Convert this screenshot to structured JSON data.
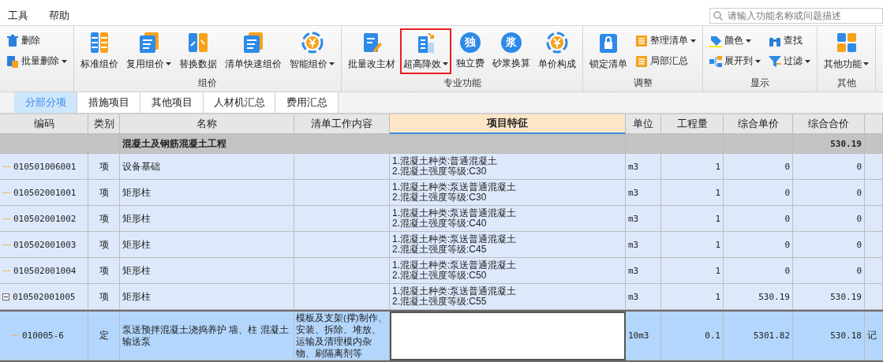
{
  "menu": [
    {
      "label": "工具"
    },
    {
      "label": "帮助"
    }
  ],
  "search": {
    "placeholder": "请输入功能名称或问题描述"
  },
  "ribbon": [
    {
      "items": [
        {
          "label": "删除",
          "kind": "small",
          "dropdown": false,
          "highlighted": false
        },
        {
          "label": "批量删除",
          "kind": "small",
          "dropdown": true,
          "highlighted": false
        }
      ]
    },
    {
      "label": "组价",
      "items": [
        {
          "label": "标准组价",
          "kind": "large",
          "dropdown": false,
          "highlighted": false
        },
        {
          "label": "复用组价",
          "kind": "large",
          "dropdown": true,
          "highlighted": false
        },
        {
          "label": "替换数据",
          "kind": "large",
          "dropdown": false,
          "highlighted": false
        },
        {
          "label": "清单快速组价",
          "kind": "large",
          "dropdown": false,
          "highlighted": false
        },
        {
          "label": "智能组价",
          "kind": "large",
          "dropdown": true,
          "highlighted": false
        }
      ]
    },
    {
      "label": "专业功能",
      "items": [
        {
          "label": "批量改主材",
          "kind": "large",
          "dropdown": false,
          "highlighted": false
        },
        {
          "label": "超高降效",
          "kind": "large",
          "dropdown": true,
          "highlighted": true
        },
        {
          "label": "独立费",
          "kind": "large",
          "glyph": "独",
          "dropdown": false,
          "highlighted": false
        },
        {
          "label": "砂浆换算",
          "kind": "large",
          "glyph": "浆",
          "dropdown": false,
          "highlighted": false
        },
        {
          "label": "单价构成",
          "kind": "large",
          "dropdown": false,
          "highlighted": false
        }
      ]
    },
    {
      "label": "调整",
      "items": [
        {
          "label": "锁定清单",
          "kind": "large",
          "dropdown": false,
          "highlighted": false
        },
        {
          "label": "整理清单",
          "kind": "small",
          "dropdown": true,
          "highlighted": false
        },
        {
          "label": "局部汇总",
          "kind": "small",
          "dropdown": false,
          "highlighted": false
        }
      ]
    },
    {
      "label": "显示",
      "items": [
        {
          "label": "颜色",
          "kind": "small",
          "dropdown": true,
          "highlighted": false
        },
        {
          "label": "展开到",
          "kind": "small",
          "dropdown": true,
          "highlighted": false
        },
        {
          "label": "查找",
          "kind": "small",
          "dropdown": false,
          "highlighted": false
        },
        {
          "label": "过滤",
          "kind": "small",
          "dropdown": true,
          "highlighted": false
        }
      ]
    },
    {
      "label": "其他",
      "items": [
        {
          "label": "其他功能",
          "kind": "large",
          "dropdown": true,
          "highlighted": false
        }
      ]
    }
  ],
  "tabs": [
    {
      "label": "分部分项",
      "selected": true
    },
    {
      "label": "措施项目",
      "selected": false
    },
    {
      "label": "其他项目",
      "selected": false
    },
    {
      "label": "人材机汇总",
      "selected": false
    },
    {
      "label": "费用汇总",
      "selected": false
    }
  ],
  "table": {
    "columns": [
      "编码",
      "类别",
      "名称",
      "清单工作内容",
      "项目特征",
      "单位",
      "工程量",
      "综合单价",
      "综合合价"
    ],
    "rows": [
      {
        "kind": "group",
        "name": "混凝土及钢筋混凝土工程",
        "total": "530.19",
        "selected": false
      },
      {
        "kind": "item",
        "code": "010501006001",
        "type": "项",
        "name": "设备基础",
        "feature": [
          "1.混凝土种类:普通混凝土",
          "2.混凝土强度等级:C30"
        ],
        "unit": "m3",
        "qty": "1",
        "price": "0",
        "total": "0",
        "selected": false,
        "expanded": false
      },
      {
        "kind": "item",
        "code": "010502001001",
        "type": "项",
        "name": "矩形柱",
        "feature": [
          "1.混凝土种类:泵送普通混凝土",
          "2.混凝土强度等级:C30"
        ],
        "unit": "m3",
        "qty": "1",
        "price": "0",
        "total": "0",
        "selected": false,
        "expanded": false
      },
      {
        "kind": "item",
        "code": "010502001002",
        "type": "项",
        "name": "矩形柱",
        "feature": [
          "1.混凝土种类:泵送普通混凝土",
          "2.混凝土强度等级:C40"
        ],
        "unit": "m3",
        "qty": "1",
        "price": "0",
        "total": "0",
        "selected": false,
        "expanded": false
      },
      {
        "kind": "item",
        "code": "010502001003",
        "type": "项",
        "name": "矩形柱",
        "feature": [
          "1.混凝土种类:泵送普通混凝土",
          "2.混凝土强度等级:C45"
        ],
        "unit": "m3",
        "qty": "1",
        "price": "0",
        "total": "0",
        "selected": false,
        "expanded": false
      },
      {
        "kind": "item",
        "code": "010502001004",
        "type": "项",
        "name": "矩形柱",
        "feature": [
          "1.混凝土种类:泵送普通混凝土",
          "2.混凝土强度等级:C50"
        ],
        "unit": "m3",
        "qty": "1",
        "price": "0",
        "total": "0",
        "selected": false,
        "expanded": false
      },
      {
        "kind": "item",
        "code": "010502001005",
        "type": "项",
        "name": "矩形柱",
        "feature": [
          "1.混凝土种类:泵送普通混凝土",
          "2.混凝土强度等级:C55"
        ],
        "unit": "m3",
        "qty": "1",
        "price": "530.19",
        "total": "530.19",
        "selected": false,
        "expanded": true
      },
      {
        "kind": "quota",
        "code": "010005-6",
        "type": "定",
        "name": "泵送预拌混凝土浇捣养护 墙、柱 混凝土输送泵",
        "content": "模板及支架(撑)制作、安装、拆除、堆放、运输及清理模内杂物、刷隔离剂等",
        "unit": "10m3",
        "qty": "0.1",
        "price": "5301.82",
        "total": "530.18",
        "extra": "记",
        "selected": true
      }
    ]
  }
}
